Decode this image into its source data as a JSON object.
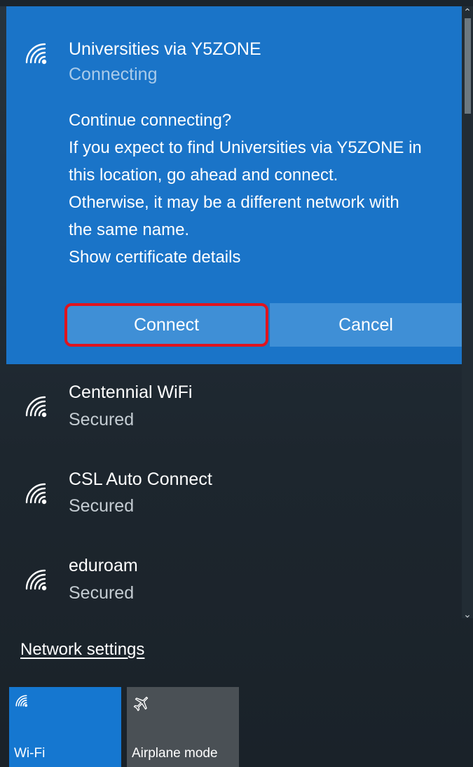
{
  "expanded_network": {
    "name": "Universities via Y5ZONE",
    "status": "Connecting",
    "prompt": "Continue connecting?",
    "message_lines": [
      "If you expect to find Universities via Y5ZONE in",
      "this location, go ahead and connect.",
      "Otherwise, it may be a different network with",
      "the same name."
    ],
    "cert_link": "Show certificate details",
    "connect_label": "Connect",
    "cancel_label": "Cancel",
    "icon": "wifi-icon"
  },
  "networks": [
    {
      "name": "Centennial WiFi",
      "status": "Secured",
      "icon": "wifi-icon"
    },
    {
      "name": "CSL Auto Connect",
      "status": "Secured",
      "icon": "wifi-icon"
    },
    {
      "name": "eduroam",
      "status": "Secured",
      "icon": "wifi-icon"
    }
  ],
  "network_settings_label": "Network settings",
  "quick_actions": [
    {
      "label": "Wi-Fi",
      "icon": "wifi-icon",
      "active": true
    },
    {
      "label": "Airplane mode",
      "icon": "airplane-icon",
      "active": false
    }
  ],
  "colors": {
    "accent": "#1a74c8",
    "button": "#3f8fd6",
    "highlight_border": "#e0141e",
    "panel_dark": "#1f2a33",
    "tile_inactive": "#4a5055"
  }
}
